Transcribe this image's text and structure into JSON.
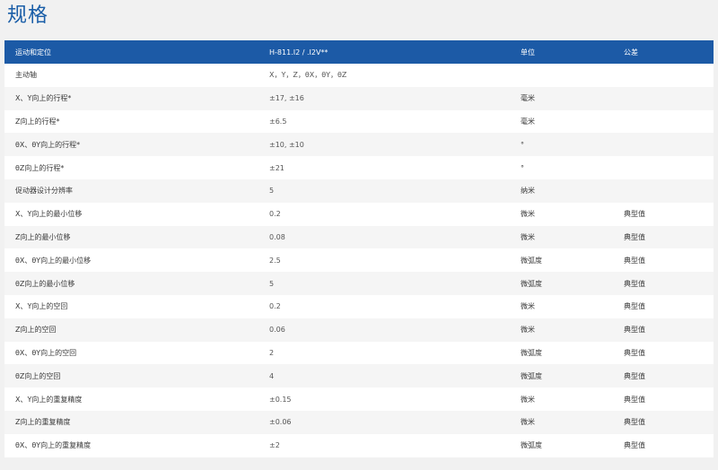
{
  "title": "规格",
  "table": {
    "headers": [
      "运动和定位",
      "H-811.I2 / .I2V**",
      "单位",
      "公差"
    ],
    "rows": [
      [
        "主动轴",
        "X，Y，Z，θX，θY，θZ",
        "",
        ""
      ],
      [
        "X、Y向上的行程*",
        "±17, ±16",
        "毫米",
        ""
      ],
      [
        "Z向上的行程*",
        "±6.5",
        "毫米",
        ""
      ],
      [
        "θX、θY向上的行程*",
        "±10, ±10",
        "°",
        ""
      ],
      [
        "θZ向上的行程*",
        "±21",
        "°",
        ""
      ],
      [
        "促动器设计分辨率",
        "5",
        "纳米",
        ""
      ],
      [
        "X、Y向上的最小位移",
        "0.2",
        "微米",
        "典型值"
      ],
      [
        "Z向上的最小位移",
        "0.08",
        "微米",
        "典型值"
      ],
      [
        "θX、θY向上的最小位移",
        "2.5",
        "微弧度",
        "典型值"
      ],
      [
        "θZ向上的最小位移",
        "5",
        "微弧度",
        "典型值"
      ],
      [
        "X、Y向上的空回",
        "0.2",
        "微米",
        "典型值"
      ],
      [
        "Z向上的空回",
        "0.06",
        "微米",
        "典型值"
      ],
      [
        "θX、θY向上的空回",
        "2",
        "微弧度",
        "典型值"
      ],
      [
        "θZ向上的空回",
        "4",
        "微弧度",
        "典型值"
      ],
      [
        "X、Y向上的重复精度",
        "±0.15",
        "微米",
        "典型值"
      ],
      [
        "Z向上的重复精度",
        "±0.06",
        "微米",
        "典型值"
      ],
      [
        "θX、θY向上的重复精度",
        "±2",
        "微弧度",
        "典型值"
      ]
    ]
  },
  "colors": {
    "title": "#1a5ea8",
    "header_bg": "#1c5aa6",
    "page_bg": "#f1f1f1"
  }
}
